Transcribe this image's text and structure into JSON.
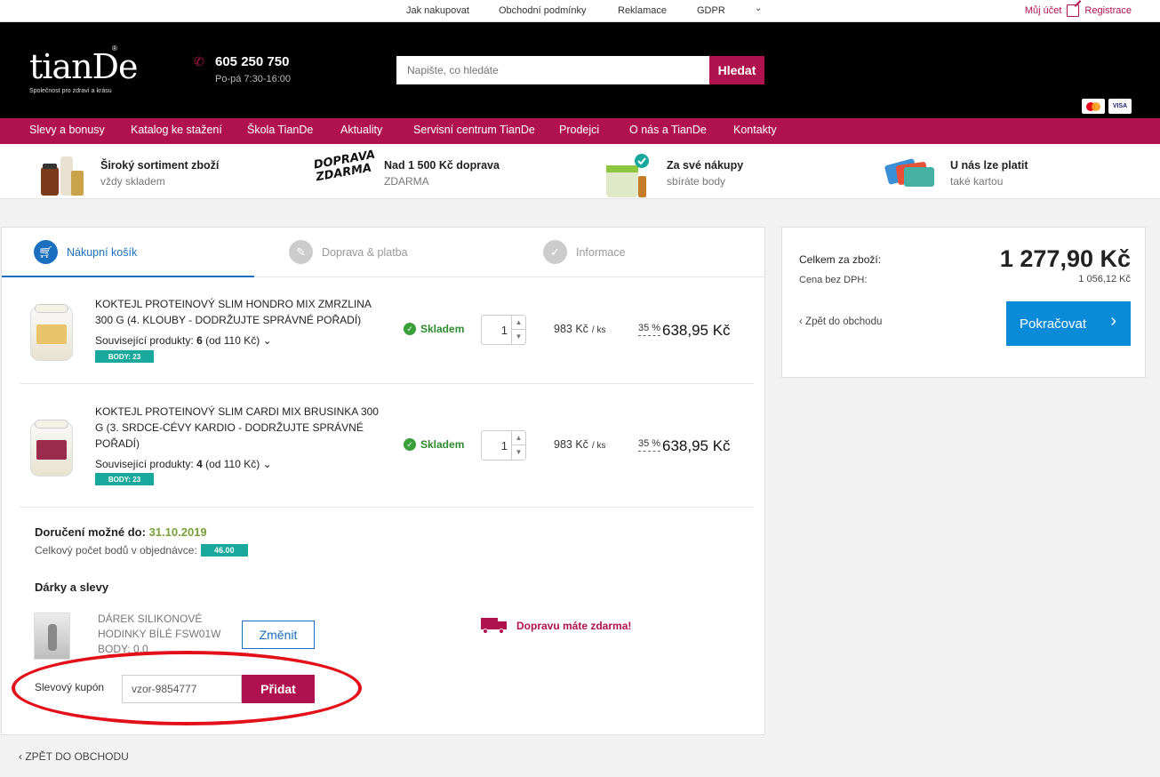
{
  "topbar": {
    "links": [
      "Jak nakupovat",
      "Obchodní podmínky",
      "Reklamace",
      "GDPR"
    ],
    "account": "Můj účet",
    "register": "Registrace"
  },
  "header": {
    "logo": "tianDe",
    "tagline": "Společnost pro zdraví a krásu",
    "phone": "605 250 750",
    "hours": "Po-pá 7:30-16:00",
    "search_placeholder": "Napište, co hledáte",
    "search_button": "Hledat",
    "cards": [
      "mastercard",
      "VISA"
    ]
  },
  "nav": [
    "Slevy a bonusy",
    "Katalog ke stažení",
    "Škola TianDe",
    "Aktuality",
    "Servisní centrum TianDe",
    "Prodejci",
    "O nás a TianDe",
    "Kontakty"
  ],
  "benefits": [
    {
      "title": "Široký sortiment zboží",
      "subtitle": "vždy skladem",
      "icon": "products-icon"
    },
    {
      "title": "Nad 1 500 Kč doprava",
      "subtitle": "ZDARMA",
      "icon": "free-delivery-icon",
      "icon_text": "DOPRAVA ZDARMA"
    },
    {
      "title": "Za své nákupy",
      "subtitle": "sbíráte body",
      "icon": "points-jar-icon"
    },
    {
      "title": "U nás lze platit",
      "subtitle": "také kartou",
      "icon": "credit-cards-icon"
    }
  ],
  "steps": [
    {
      "label": "Nákupní košík",
      "active": true
    },
    {
      "label": "Doprava & platba",
      "active": false
    },
    {
      "label": "Informace",
      "active": false
    }
  ],
  "items": [
    {
      "name": "KOKTEJL PROTEINOVÝ SLIM HONDRO MIX ZMRZLINA 300 G (4. KLOUBY - DODRŽUJTE SPRÁVNÉ POŘADÍ)",
      "related_label": "Související produkty:",
      "related_count": "6",
      "related_from": "(od 110 Kč)",
      "body": "BODY: 23",
      "stock": "Skladem",
      "qty": "1",
      "price": "983 Kč",
      "per": "/ ks",
      "discount": "35 %",
      "final": "638,95 Kč"
    },
    {
      "name": "KOKTEJL PROTEINOVÝ SLIM CARDI MIX BRUSINKA 300 G (3. SRDCE-CÉVY KARDIO - DODRŽUJTE SPRÁVNÉ POŘADÍ)",
      "related_label": "Související produkty:",
      "related_count": "4",
      "related_from": "(od 110 Kč)",
      "body": "BODY: 23",
      "stock": "Skladem",
      "qty": "1",
      "price": "983 Kč",
      "per": "/ ks",
      "discount": "35 %",
      "final": "638,95 Kč"
    }
  ],
  "delivery": {
    "label": "Doručení možné do:",
    "date": "31.10.2019"
  },
  "points": {
    "label": "Celkový počet bodů v objednávce:",
    "value": "46.00"
  },
  "gifts": {
    "title": "Dárky a slevy",
    "gift_name": "DÁREK SILIKONOVÉ HODINKY BÍLÉ FSW01W",
    "gift_body": "BODY: 0.0",
    "change": "Změnit",
    "free_shipping": "Dopravu máte zdarma!"
  },
  "coupon": {
    "label": "Slevový kupón",
    "value": "vzor-9854777",
    "button": "Přidat"
  },
  "back_bottom": "ZPĚT DO OBCHODU",
  "summary": {
    "total_label": "Celkem za zboží:",
    "net_label": "Cena bez DPH:",
    "total": "1 277,90 Kč",
    "net": "1 056,12 Kč",
    "back": "Zpět do obchodu",
    "continue": "Pokračovat"
  },
  "colors": {
    "brand": "#b0114f",
    "accent": "#0a8bd8",
    "success": "#2e8b2e",
    "points": "#18a99c",
    "highlight": "#e3101a"
  }
}
